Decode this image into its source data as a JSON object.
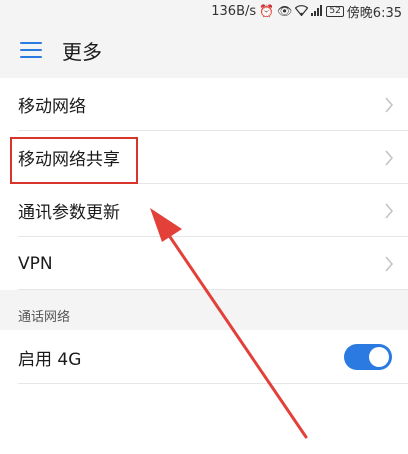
{
  "statusbar": {
    "speed": "136B/s",
    "battery": "52",
    "time": "傍晚6:35",
    "icons": [
      "alarm-icon",
      "eye-icon",
      "wifi-icon",
      "signal-icon",
      "battery-icon"
    ]
  },
  "header": {
    "title": "更多",
    "menu_icon": "hamburger-icon"
  },
  "list": {
    "items": [
      {
        "label": "移动网络"
      },
      {
        "label": "移动网络共享"
      },
      {
        "label": "通讯参数更新"
      },
      {
        "label": "VPN"
      }
    ]
  },
  "section": {
    "label": "通话网络"
  },
  "toggle": {
    "label": "启用 4G",
    "on": true
  },
  "colors": {
    "accent": "#2a7ae2",
    "highlight": "#d9342b"
  }
}
